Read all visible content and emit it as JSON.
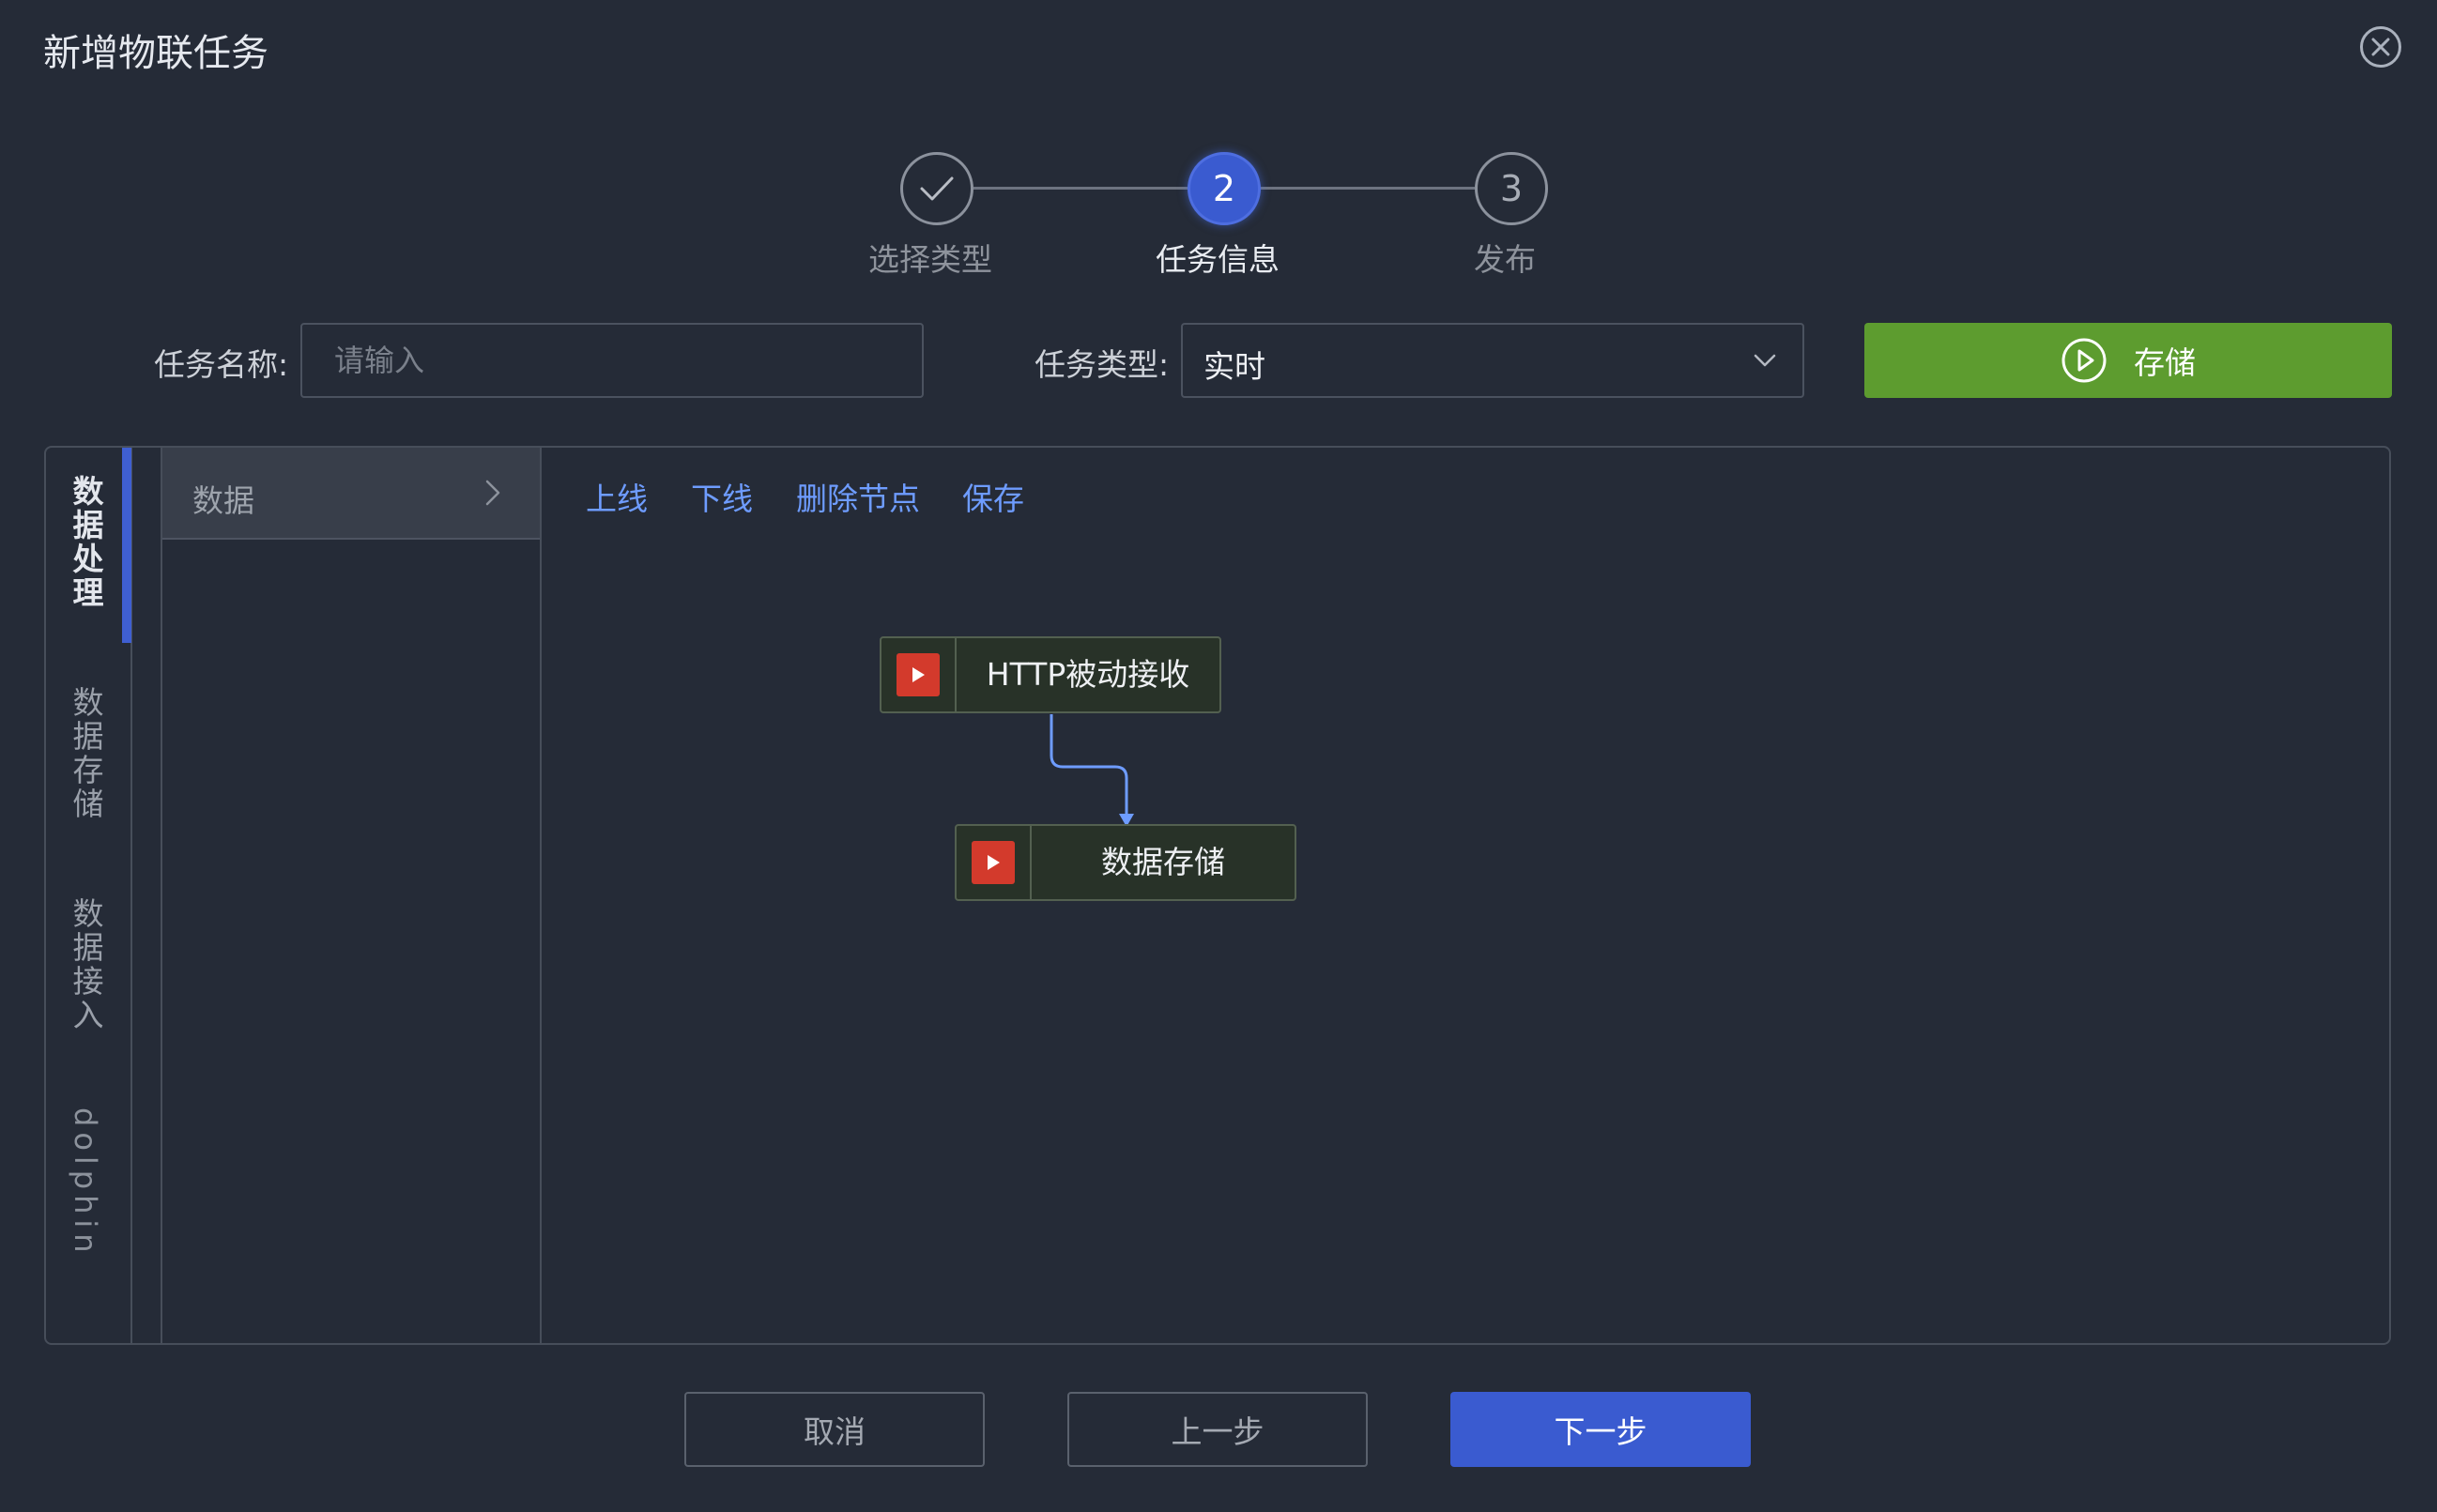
{
  "dialog": {
    "title": "新增物联任务"
  },
  "steps": [
    {
      "label": "选择类型",
      "state": "done"
    },
    {
      "label": "任务信息",
      "number": "2",
      "state": "active"
    },
    {
      "label": "发布",
      "number": "3",
      "state": "todo"
    }
  ],
  "form": {
    "name_label": "任务名称:",
    "name_placeholder": "请输入",
    "name_value": "",
    "type_label": "任务类型:",
    "type_value": "实时",
    "save_label": "存储"
  },
  "side_tabs": [
    {
      "label": "数据处理",
      "active": true
    },
    {
      "label": "数据存储",
      "active": false
    },
    {
      "label": "数据接入",
      "active": false
    },
    {
      "label": "dolphin",
      "active": false
    }
  ],
  "category": {
    "label": "数据"
  },
  "toolbar": {
    "online": "上线",
    "offline": "下线",
    "delete_node": "删除节点",
    "save": "保存"
  },
  "flow": {
    "nodes": [
      {
        "label": "HTTP被动接收",
        "icon": "play-icon"
      },
      {
        "label": "数据存储",
        "icon": "play-icon"
      }
    ]
  },
  "footer": {
    "cancel": "取消",
    "prev": "上一步",
    "next": "下一步"
  },
  "colors": {
    "accent": "#3a5bd0",
    "save_green": "#5d9c2f",
    "link": "#6e9cff",
    "node_icon_red": "#d33a2c"
  }
}
